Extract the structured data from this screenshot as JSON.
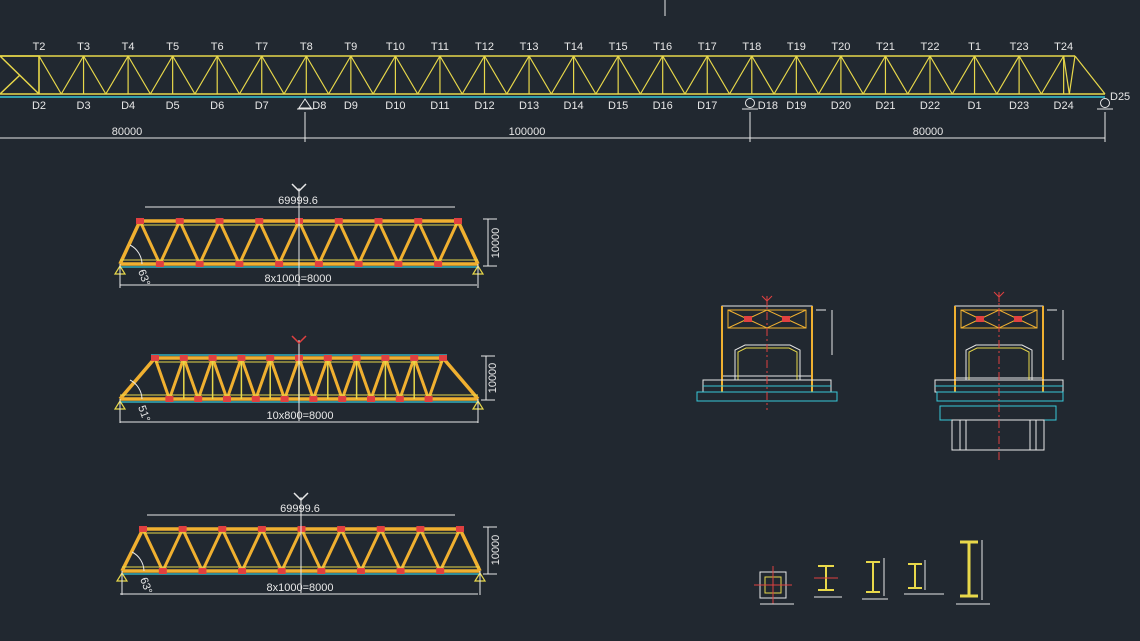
{
  "top_truss": {
    "top_nodes": [
      "T2",
      "T3",
      "T4",
      "T5",
      "T6",
      "T7",
      "T8",
      "T9",
      "T10",
      "T11",
      "T12",
      "T13",
      "T14",
      "T15",
      "T16",
      "T17",
      "T18",
      "T19",
      "T20",
      "T21",
      "T22",
      "T1",
      "T23",
      "T24"
    ],
    "bottom_nodes": [
      "D2",
      "D3",
      "D4",
      "D5",
      "D6",
      "D7",
      "D8",
      "D9",
      "D10",
      "D11",
      "D12",
      "D13",
      "D14",
      "D15",
      "D16",
      "D17",
      "D18",
      "D19",
      "D20",
      "D21",
      "D22",
      "D1",
      "D23",
      "D24"
    ],
    "end_node": "D25",
    "spans": [
      "80000",
      "100000",
      "80000"
    ]
  },
  "elevation_1": {
    "span_label": "69999.6",
    "height_label": "10000",
    "panel_label": "8x1000=8000",
    "angle_label": "63°"
  },
  "elevation_2": {
    "height_label": "10000",
    "panel_label": "10x800=8000",
    "angle_label": "51°"
  },
  "elevation_3": {
    "span_label": "69999.6",
    "height_label": "10000",
    "panel_label": "8x1000=8000",
    "angle_label": "63°"
  },
  "colors": {
    "background": "#212830",
    "truss": "#e8d84a",
    "chord": "#f0b030",
    "joint": "#e04040",
    "cyan": "#38c8d8",
    "white": "#e8e8e8"
  }
}
